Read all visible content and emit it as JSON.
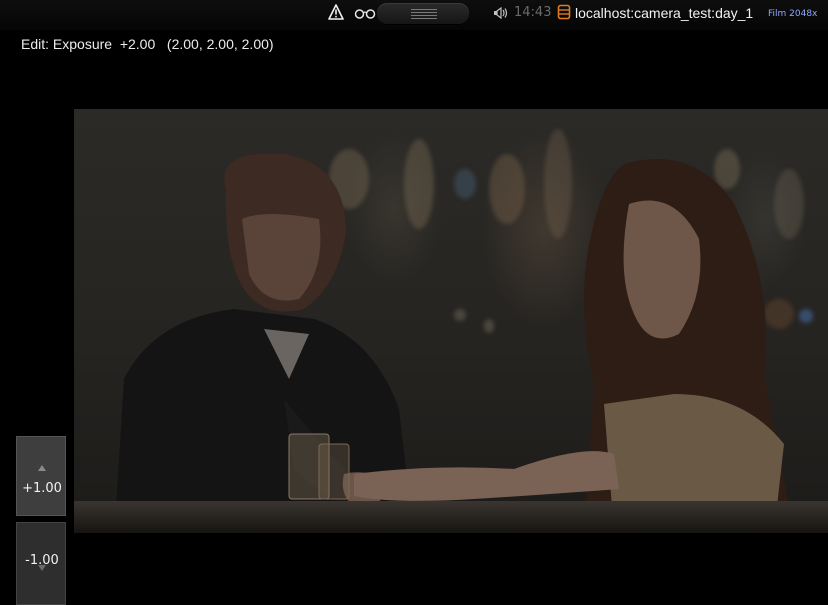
{
  "status_bar": {
    "clock": "14:43",
    "session": "localhost:camera_test:day_1",
    "format": "Film 2048x",
    "icons": [
      "warning-icon",
      "glasses-icon",
      "speaker-icon",
      "database-icon"
    ]
  },
  "edit": {
    "label": "Edit: Exposure  +2.00   (2.00, 2.00, 2.00)"
  },
  "controls": {
    "increase_label": "+1.00",
    "decrease_label": "-1.00"
  },
  "colors": {
    "accent_orange": "#e07a1e",
    "format_blue": "#8fa8ff"
  }
}
